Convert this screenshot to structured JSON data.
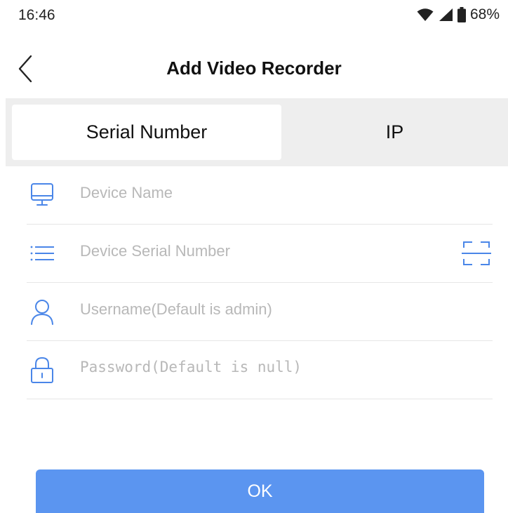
{
  "status_bar": {
    "time": "16:46",
    "battery": "68%",
    "icons": [
      "wifi-icon",
      "signal-icon",
      "battery-icon"
    ]
  },
  "header": {
    "title": "Add Video Recorder",
    "back_icon": "chevron-left-icon"
  },
  "tabs": [
    {
      "label": "Serial Number",
      "selected": true
    },
    {
      "label": "IP",
      "selected": false
    }
  ],
  "form": {
    "device_name": {
      "placeholder": "Device Name",
      "value": "",
      "icon": "monitor-icon"
    },
    "serial_number": {
      "placeholder": "Device Serial Number",
      "value": "",
      "icon": "list-icon",
      "action_icon": "scan-icon"
    },
    "username": {
      "placeholder": "Username(Default is admin)",
      "value": "",
      "icon": "user-icon"
    },
    "password": {
      "placeholder": "Password(Default is null)",
      "value": "",
      "icon": "lock-icon"
    }
  },
  "ok_button": {
    "label": "OK"
  },
  "colors": {
    "accent": "#5b95f0",
    "icon": "#4a86e8",
    "tab_bg": "#eeeeee",
    "placeholder": "#b8b8b8"
  }
}
